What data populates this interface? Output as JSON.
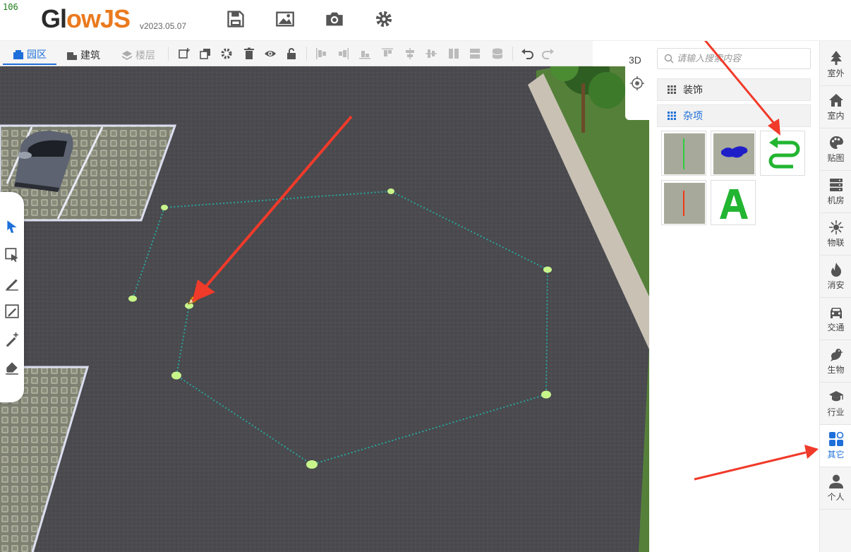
{
  "header": {
    "fps": "106",
    "logo_main": "Gl",
    "logo_accent_o": "ow",
    "logo_accent": "JS",
    "version": "v2023.05.07"
  },
  "toolbar": {
    "tabs": [
      {
        "label": "园区",
        "state": "active"
      },
      {
        "label": "建筑",
        "state": "normal"
      },
      {
        "label": "楼层",
        "state": "disabled"
      }
    ]
  },
  "view": {
    "mode_label": "3D"
  },
  "panel": {
    "search_placeholder": "请输入搜索内容",
    "categories": [
      {
        "label": "装饰"
      },
      {
        "label": "杂项"
      }
    ]
  },
  "sidenav": {
    "items": [
      {
        "label": "室外",
        "icon": "tree-icon"
      },
      {
        "label": "室内",
        "icon": "house-icon"
      },
      {
        "label": "贴图",
        "icon": "palette-icon"
      },
      {
        "label": "机房",
        "icon": "server-icon"
      },
      {
        "label": "物联",
        "icon": "iot-icon"
      },
      {
        "label": "消安",
        "icon": "fire-icon"
      },
      {
        "label": "交通",
        "icon": "car-icon"
      },
      {
        "label": "生物",
        "icon": "bird-icon"
      },
      {
        "label": "行业",
        "icon": "graduation-cap-icon"
      },
      {
        "label": "其它",
        "icon": "shapes-icon",
        "active": true
      },
      {
        "label": "个人",
        "icon": "user-icon"
      }
    ]
  },
  "colors": {
    "accent": "#1e6fd9",
    "logo_orange": "#ea7a1e",
    "asphalt": "#4a4a4f",
    "annotation_red": "#f03a2a",
    "point_green": "#c8f58a",
    "dotted_line": "#2aa59b"
  }
}
